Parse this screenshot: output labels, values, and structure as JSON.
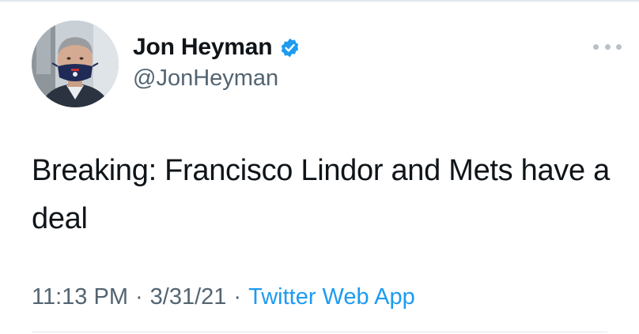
{
  "tweet": {
    "author": {
      "display_name": "Jon Heyman",
      "handle": "@JonHeyman",
      "verified": true,
      "avatar_icon": "profile-photo-masked-man"
    },
    "text": "Breaking: Francisco Lindor and Mets have a deal",
    "time": "11:13 PM",
    "separator": "·",
    "date": "3/31/21",
    "source": "Twitter Web App",
    "more_icon": "ellipsis-icon"
  },
  "colors": {
    "primary_text": "#0f1419",
    "secondary_text": "#536471",
    "link": "#1d9bf0",
    "verified_badge": "#1d9bf0",
    "divider": "#e1e8ed"
  }
}
